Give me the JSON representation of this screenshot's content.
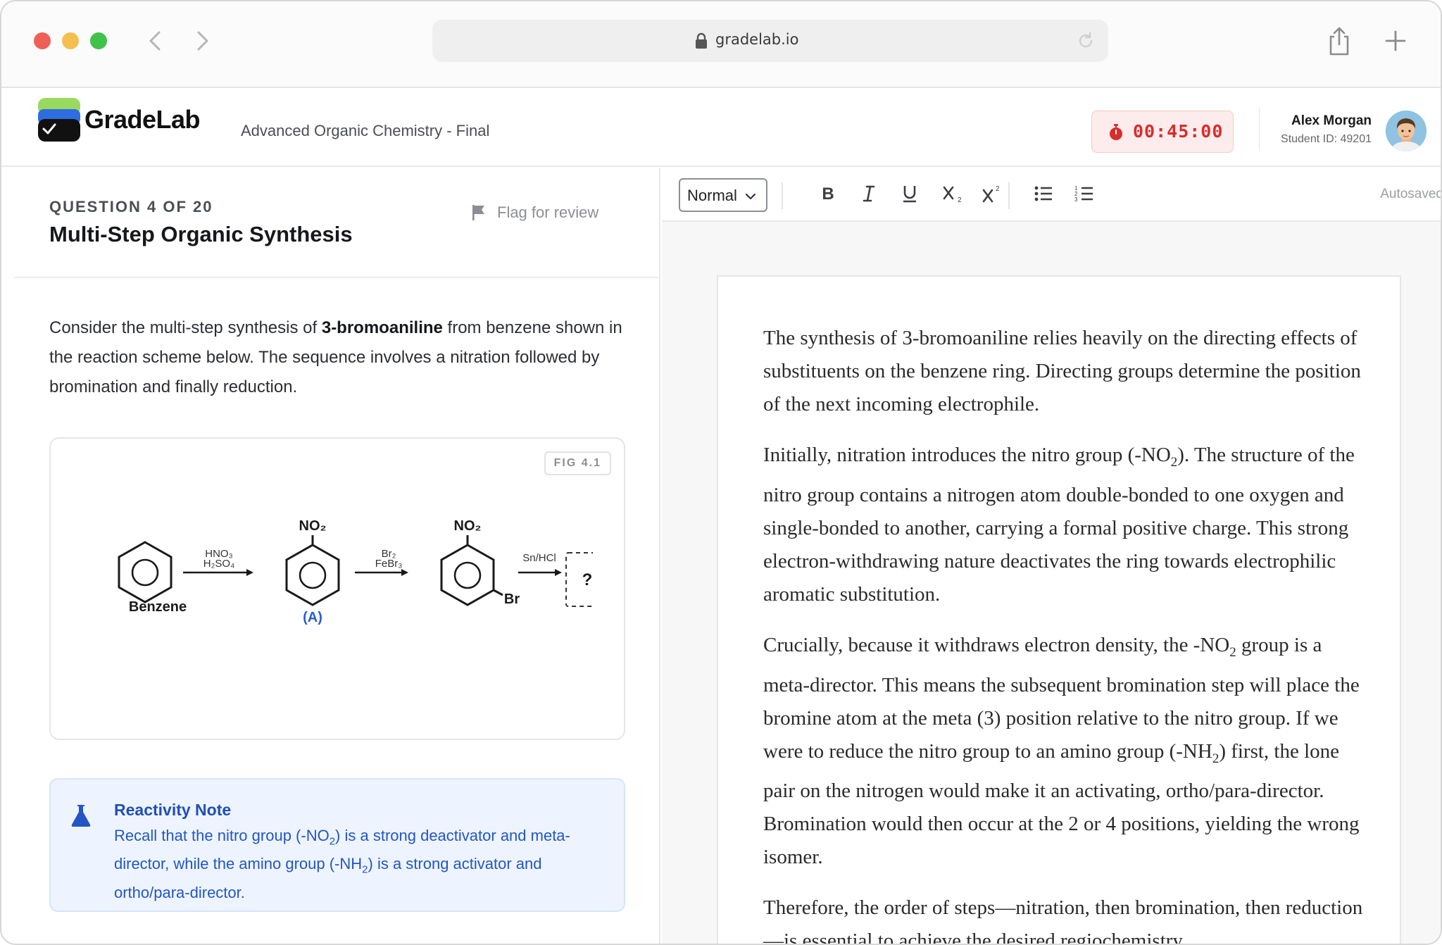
{
  "browser": {
    "url": "gradelab.io",
    "traffic_lights": [
      "close",
      "minimize",
      "zoom"
    ],
    "icons": [
      "back-arrow-icon",
      "forward-arrow-icon",
      "lock-icon",
      "reload-icon",
      "share-icon",
      "plus-icon"
    ]
  },
  "header": {
    "brand": "GradeLab",
    "exam_title": "Advanced Organic Chemistry - Final",
    "timer": "00:45:00",
    "user_name": "Alex Morgan",
    "student_id": "Student ID: 49201"
  },
  "question": {
    "counter": "QUESTION 4 OF 20",
    "title": "Multi-Step Organic Synthesis",
    "flag_label": "Flag for review",
    "body_before": "Consider the multi-step synthesis of ",
    "body_bold": "3-bromoaniline",
    "body_after": " from benzene shown in the reaction scheme below. The sequence involves a nitration followed by bromination and finally reduction.",
    "figure": {
      "tag": "FIG 4.1",
      "start_label": "Benzene",
      "intermediate_label": "(A)",
      "no2_label": "NO₂",
      "br_label": "Br",
      "step1_reagents": [
        "HNO₃",
        "H₂SO₄"
      ],
      "step2_reagents": [
        "Br₂",
        "FeBr₃"
      ],
      "step3_reagents": [
        "Sn/HCl"
      ],
      "unknown_label": "?"
    },
    "note": {
      "title": "Reactivity Note",
      "line1_a": "Recall that the nitro group (-NO",
      "line1_sub": "2",
      "line1_b": ") is a strong deactivator and meta-director, while the amino group (-NH",
      "line1_sub2": "2",
      "line1_c": ") is a strong activator and ortho/para-director."
    }
  },
  "editor": {
    "style_value": "Normal",
    "toolbar_buttons": [
      "bold",
      "italic",
      "underline",
      "subscript",
      "superscript",
      "bulleted-list",
      "numbered-list"
    ],
    "autosave_status": "Autosaved",
    "paragraphs": {
      "p1": "The synthesis of 3-bromoaniline relies heavily on the directing effects of substituents on the benzene ring. Directing groups determine the position of the next incoming electrophile.",
      "p2_a": "Initially, nitration introduces the nitro group (-NO",
      "p2_sub": "2",
      "p2_b": "). The structure of the nitro group contains a nitrogen atom double-bonded to one oxygen and single-bonded to another, carrying a formal positive charge. This strong electron-withdrawing nature deactivates the ring towards electrophilic aromatic substitution.",
      "p3_a": "Crucially, because it withdraws electron density, the -NO",
      "p3_sub": "2",
      "p3_b": " group is a meta-director. This means the subsequent bromination step will place the bromine atom at the meta (3) position relative to the nitro group. If we were to reduce the nitro group to an amino group (-NH",
      "p3_sub2": "2",
      "p3_c": ") first, the lone pair on the nitrogen would make it an activating, ortho/para-director. Bromination would then occur at the 2 or 4 positions, yielding the wrong isomer.",
      "p4": "Therefore, the order of steps—nitration, then bromination, then reduction—is essential to achieve the desired regiochemistry..."
    }
  },
  "colors": {
    "timer_red": "#d92c2c",
    "note_blue": "#2256c4",
    "note_bg": "#eef4ff",
    "label_blue": "#2b5bd0"
  }
}
